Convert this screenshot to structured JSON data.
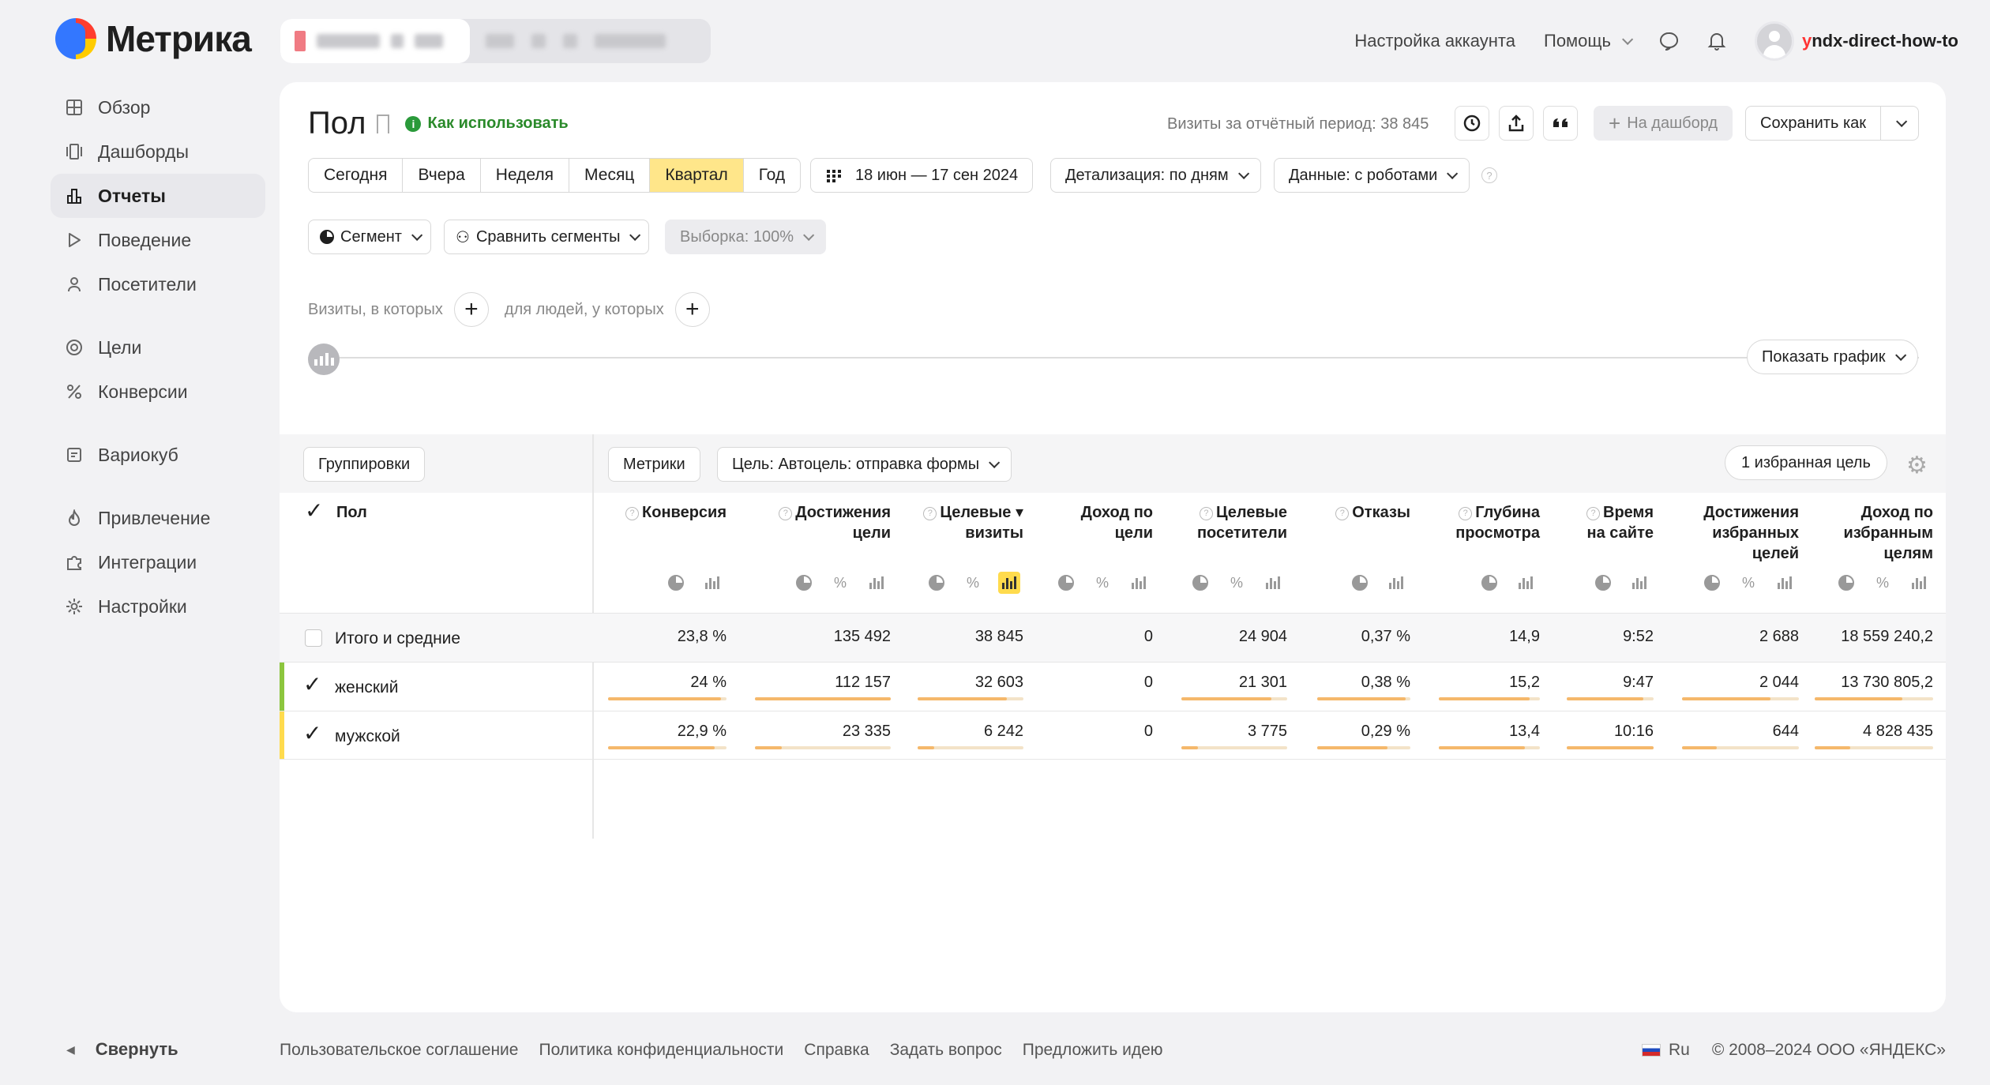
{
  "app": {
    "logo_text": "Метрика"
  },
  "topbar": {
    "account_settings": "Настройка аккаунта",
    "help": "Помощь",
    "username_first": "y",
    "username_rest": "ndx-direct-how-to"
  },
  "sidebar": {
    "items": [
      {
        "label": "Обзор",
        "icon": "grid-icon"
      },
      {
        "label": "Дашборды",
        "icon": "dashboards-icon"
      },
      {
        "label": "Отчеты",
        "icon": "reports-icon",
        "active": true
      },
      {
        "label": "Поведение",
        "icon": "play-icon"
      },
      {
        "label": "Посетители",
        "icon": "user-icon"
      },
      {
        "label": "Цели",
        "icon": "target-icon"
      },
      {
        "label": "Конверсии",
        "icon": "percent-icon"
      },
      {
        "label": "Вариокуб",
        "icon": "variocube-icon"
      },
      {
        "label": "Привлечение",
        "icon": "flame-icon"
      },
      {
        "label": "Интеграции",
        "icon": "puzzle-icon"
      },
      {
        "label": "Настройки",
        "icon": "gear-icon"
      }
    ],
    "collapse": "Свернуть"
  },
  "report": {
    "title": "Пол",
    "how_to_use": "Как использовать",
    "visits_period": "Визиты за отчётный период: 38 845",
    "to_dashboard": "На дашборд",
    "save_as": "Сохранить как",
    "periods": [
      "Сегодня",
      "Вчера",
      "Неделя",
      "Месяц",
      "Квартал",
      "Год"
    ],
    "selected_period": "Квартал",
    "date_range": "18 июн — 17 сен 2024",
    "detail": "Детализация: по дням",
    "data_mode": "Данные: с роботами",
    "segment": "Сегмент",
    "compare_segments": "Сравнить сегменты",
    "sample": "Выборка: 100%",
    "visits_where": "Визиты, в которых",
    "people_where": "для людей, у которых",
    "show_chart": "Показать график"
  },
  "table": {
    "groupings": "Группировки",
    "metrics": "Метрики",
    "goal": "Цель: Автоцель: отправка формы",
    "fav_goal": "1 избранная цель",
    "dim_header": "Пол",
    "columns": [
      {
        "lines": [
          "Конверсия"
        ],
        "help": true
      },
      {
        "lines": [
          "Достижения",
          "цели"
        ],
        "help": true
      },
      {
        "lines": [
          "Целевые ▾",
          "визиты"
        ],
        "help": true
      },
      {
        "lines": [
          "Доход по",
          "цели"
        ],
        "help": false
      },
      {
        "lines": [
          "Целевые",
          "посетители"
        ],
        "help": true
      },
      {
        "lines": [
          "Отказы"
        ],
        "help": true
      },
      {
        "lines": [
          "Глубина",
          "просмотра"
        ],
        "help": true
      },
      {
        "lines": [
          "Время",
          "на сайте"
        ],
        "help": true
      },
      {
        "lines": [
          "Достижения",
          "избранных",
          "целей"
        ],
        "help": false
      },
      {
        "lines": [
          "Доход по",
          "избранным",
          "целям"
        ],
        "help": false
      }
    ],
    "rows": [
      {
        "label": "Итого и средние",
        "values": [
          "23,8 %",
          "135 492",
          "38 845",
          "0",
          "24 904",
          "0,37 %",
          "14,9",
          "9:52",
          "2 688",
          "18 559 240,2"
        ]
      },
      {
        "label": "женский",
        "color": "#8cc63e",
        "values": [
          "24 %",
          "112 157",
          "32 603",
          "0",
          "21 301",
          "0,38 %",
          "15,2",
          "9:47",
          "2 044",
          "13 730 805,2"
        ],
        "shares": [
          0.95,
          1.0,
          0.84,
          0,
          0.85,
          0.95,
          0.9,
          0.88,
          0.76,
          0.74
        ]
      },
      {
        "label": "мужской",
        "color": "#ffdb4d",
        "values": [
          "22,9 %",
          "23 335",
          "6 242",
          "0",
          "3 775",
          "0,29 %",
          "13,4",
          "10:16",
          "644",
          "4 828 435"
        ],
        "shares": [
          0.9,
          0.2,
          0.16,
          0,
          0.16,
          0.75,
          0.85,
          1.0,
          0.3,
          0.3
        ]
      }
    ]
  },
  "footer": {
    "links": [
      "Пользовательское соглашение",
      "Политика конфиденциальности",
      "Справка",
      "Задать вопрос",
      "Предложить идею"
    ],
    "lang": "Ru",
    "copyright": "© 2008–2024 ООО «ЯНДЕКС»"
  }
}
